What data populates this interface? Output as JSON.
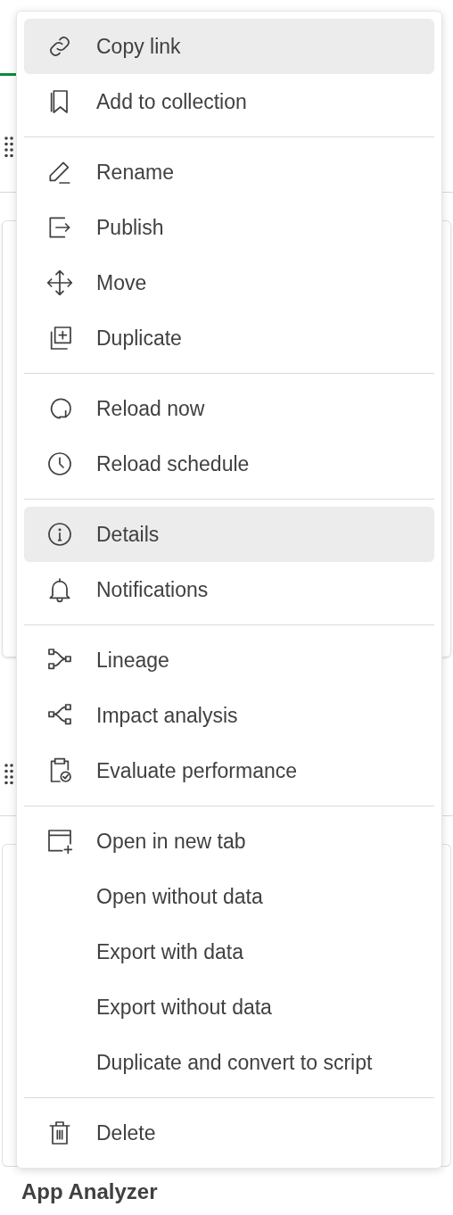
{
  "background": {
    "title": "App Analyzer"
  },
  "menu": {
    "groups": [
      {
        "items": [
          {
            "label": "Copy link",
            "kind": "icon",
            "highlighted": true
          },
          {
            "label": "Add to collection",
            "kind": "icon",
            "highlighted": false
          }
        ]
      },
      {
        "items": [
          {
            "label": "Rename",
            "kind": "icon",
            "highlighted": false
          },
          {
            "label": "Publish",
            "kind": "icon",
            "highlighted": false
          },
          {
            "label": "Move",
            "kind": "icon",
            "highlighted": false
          },
          {
            "label": "Duplicate",
            "kind": "icon",
            "highlighted": false
          }
        ]
      },
      {
        "items": [
          {
            "label": "Reload now",
            "kind": "icon",
            "highlighted": false
          },
          {
            "label": "Reload schedule",
            "kind": "icon",
            "highlighted": false
          }
        ]
      },
      {
        "items": [
          {
            "label": "Details",
            "kind": "icon",
            "highlighted": true
          },
          {
            "label": "Notifications",
            "kind": "icon",
            "highlighted": false
          }
        ]
      },
      {
        "items": [
          {
            "label": "Lineage",
            "kind": "icon",
            "highlighted": false
          },
          {
            "label": "Impact analysis",
            "kind": "icon",
            "highlighted": false
          },
          {
            "label": "Evaluate performance",
            "kind": "icon",
            "highlighted": false
          }
        ]
      },
      {
        "items": [
          {
            "label": "Open in new tab",
            "kind": "icon",
            "highlighted": false
          },
          {
            "label": "Open without data",
            "kind": "plain",
            "highlighted": false
          },
          {
            "label": "Export with data",
            "kind": "plain",
            "highlighted": false
          },
          {
            "label": "Export without data",
            "kind": "plain",
            "highlighted": false
          },
          {
            "label": "Duplicate and convert to script",
            "kind": "plain",
            "highlighted": false
          }
        ]
      },
      {
        "items": [
          {
            "label": "Delete",
            "kind": "icon",
            "highlighted": false
          }
        ]
      }
    ]
  }
}
